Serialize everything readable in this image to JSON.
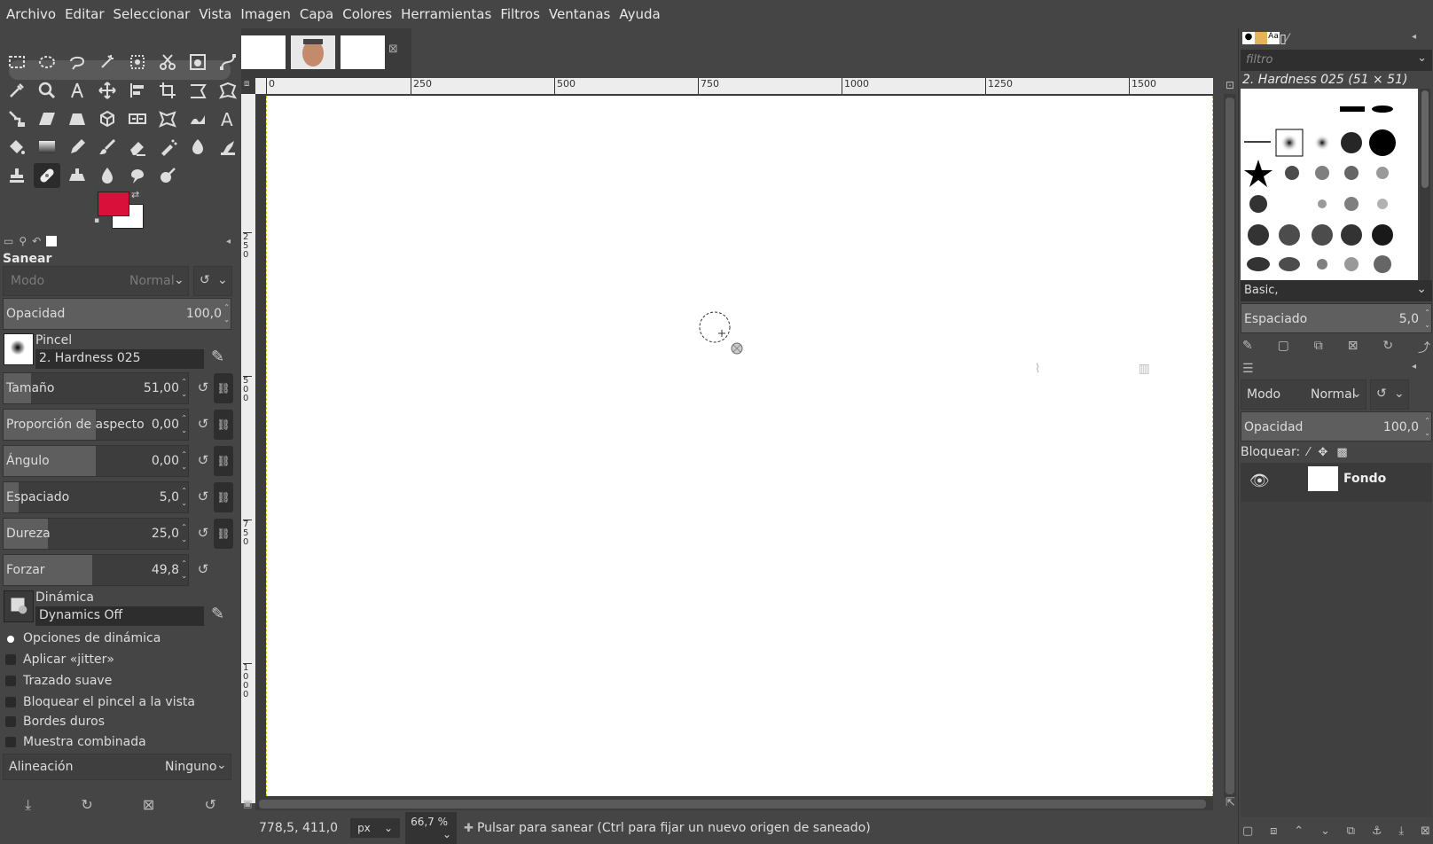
{
  "menu": [
    "Archivo",
    "Editar",
    "Seleccionar",
    "Vista",
    "Imagen",
    "Capa",
    "Colores",
    "Herramientas",
    "Filtros",
    "Ventanas",
    "Ayuda"
  ],
  "colors": {
    "foreground": "#d9113a",
    "background": "#ffffff",
    "ui": "#454545",
    "canvas": "#ffffff"
  },
  "tool_options": {
    "title": "Sanear",
    "mode_label": "Modo",
    "mode_value": "Normal",
    "opacity": {
      "label": "Opacidad",
      "value": "100,0",
      "fraction": 1.0
    },
    "brush_section": "Pincel",
    "brush_value": "2. Hardness 025",
    "sliders": [
      {
        "label": "Tamaño",
        "value": "51,00",
        "fraction": 0.15
      },
      {
        "label": "Proporción de aspecto",
        "value": "0,00",
        "fraction": 0.5
      },
      {
        "label": "Ángulo",
        "value": "0,00",
        "fraction": 0.5
      },
      {
        "label": "Espaciado",
        "value": "5,0",
        "fraction": 0.08
      },
      {
        "label": "Dureza",
        "value": "25,0",
        "fraction": 0.24
      },
      {
        "label": "Forzar",
        "value": "49,8",
        "fraction": 0.48
      }
    ],
    "dynamics_section": "Dinámica",
    "dynamics_value": "Dynamics Off",
    "checks": [
      {
        "label": "Opciones de dinámica",
        "checked": false
      },
      {
        "label": "Aplicar «jitter»",
        "checked": false
      },
      {
        "label": "Trazado suave",
        "checked": false
      },
      {
        "label": "Bloquear el pincel a la vista",
        "checked": false
      },
      {
        "label": "Bordes duros",
        "checked": false
      },
      {
        "label": "Muestra combinada",
        "checked": false
      }
    ],
    "alignment_label": "Alineación",
    "alignment_value": "Ninguno"
  },
  "rulers": {
    "h_ticks": [
      "0",
      "250",
      "500",
      "750",
      "1000",
      "1250",
      "1500"
    ],
    "v_ticks": [
      "2 5 0",
      "5 0 0",
      "7 5 0",
      "1 0 0 0"
    ]
  },
  "status": {
    "coords": "778,5, 411,0",
    "unit": "px",
    "zoom": "66,7 %",
    "message": "Pulsar para sanear (Ctrl para fijar un nuevo origen de saneado)"
  },
  "brushes": {
    "filter_placeholder": "filtro",
    "selected_name": "2. Hardness 025 (51 × 51)",
    "tags": "Basic,",
    "spacing_label": "Espaciado",
    "spacing_value": "5,0"
  },
  "layers": {
    "mode_label": "Modo",
    "mode_value": "Normal",
    "opacity_label": "Opacidad",
    "opacity_value": "100,0",
    "lock_label": "Bloquear:",
    "items": [
      {
        "name": "Fondo",
        "visible": true
      }
    ]
  }
}
